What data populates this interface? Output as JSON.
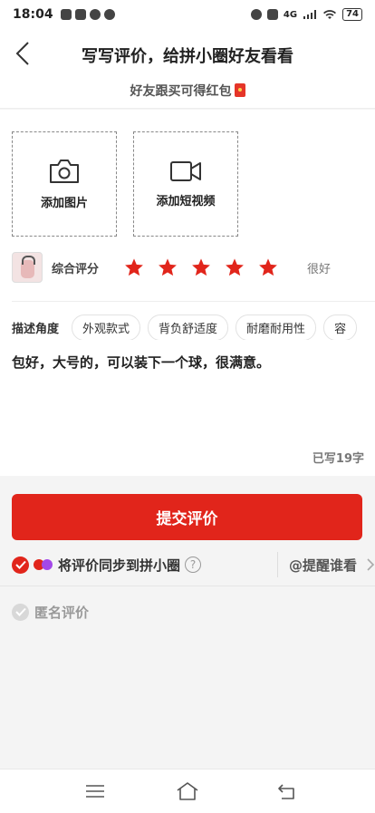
{
  "status": {
    "time": "18:04",
    "network": "4G",
    "battery": "74"
  },
  "header": {
    "title": "写写评价，给拼小圈好友看看",
    "subtitle": "好友跟买可得红包"
  },
  "upload": {
    "photo_label": "添加图片",
    "video_label": "添加短视频"
  },
  "rating": {
    "label": "综合评分",
    "stars": 5,
    "max_stars": 5,
    "text": "很好",
    "star_color": "#e1251b"
  },
  "aspects": {
    "label": "描述角度",
    "chips": [
      "外观款式",
      "背负舒适度",
      "耐磨耐用性",
      "容"
    ]
  },
  "review": {
    "text": "包好，大号的，可以装下一个球，很满意。",
    "counter": "已写19字"
  },
  "submit": {
    "label": "提交评价",
    "color": "#e1251b"
  },
  "sync": {
    "text": "将评价同步到拼小圈",
    "help": "?",
    "remind": "@提醒谁看"
  },
  "anonymous": {
    "label": "匿名评价"
  }
}
